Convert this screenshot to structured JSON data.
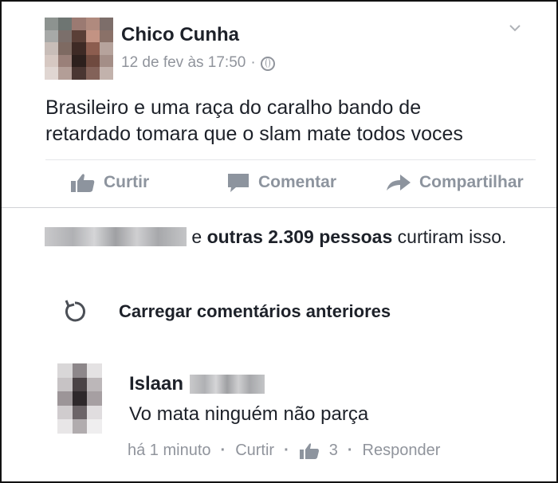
{
  "post": {
    "author": "Chico Cunha",
    "timestamp": "12 de fev às 17:50",
    "separator": "·",
    "privacy_icon": "globe-icon",
    "text_line1": "Brasileiro e uma raça do caralho bando de",
    "text_line2": "retardado tomara que o slam mate todos voces"
  },
  "actions": {
    "like_label": "Curtir",
    "comment_label": "Comentar",
    "share_label": "Compartilhar"
  },
  "likes": {
    "and_text": " e ",
    "count_text": "outras 2.309 pessoas",
    "suffix": " curtiram isso."
  },
  "comments": {
    "load_more_label": "Carregar comentários anteriores",
    "items": [
      {
        "author": "Islaan",
        "text": "Vo mata ninguém não parça",
        "time": "há 1 minuto",
        "like_label": "Curtir",
        "like_count": "3",
        "reply_label": "Responder"
      }
    ]
  },
  "colors": {
    "text": "#1d2129",
    "muted": "#90949c",
    "action": "#8d949e"
  }
}
